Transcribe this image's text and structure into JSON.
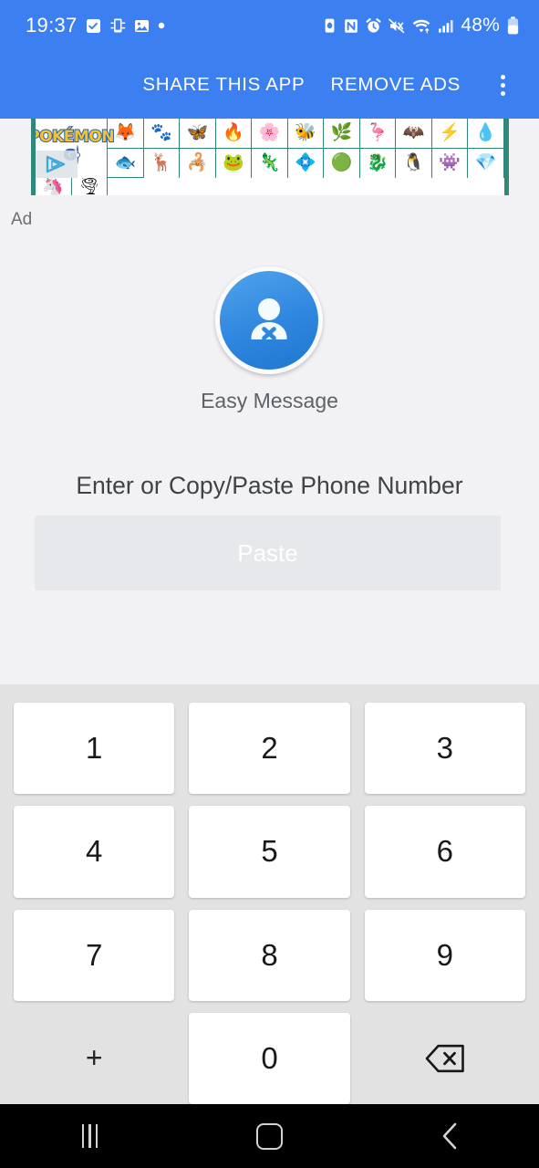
{
  "status_bar": {
    "time": "19:37",
    "battery_percent": "48%",
    "left_icons": [
      "tasks-checkbox-icon",
      "phone-link-icon",
      "gallery-image-icon",
      "dot-indicator-icon"
    ],
    "right_icons": [
      "power-saving-icon",
      "nfc-icon",
      "alarm-icon",
      "mute-vibrate-icon",
      "wifi-icon",
      "signal-bars-icon",
      "battery-icon"
    ],
    "background_color": "#3b7ff0"
  },
  "toolbar": {
    "share_label": "SHARE THIS APP",
    "remove_ads_label": "REMOVE ADS",
    "overflow_icon": "more-vertical-icon",
    "background_color": "#3b7ff0"
  },
  "ad": {
    "label": "Ad",
    "advertiser": "Pokémon GO",
    "logo_word": "POKÉMON",
    "logo_sub": "GO",
    "adchoices_icon": "adchoices-triangle-icon",
    "border_color": "#2f8878",
    "sprites_row1": [
      "🦊",
      "🐾",
      "🦋",
      "🔥",
      "🌸",
      "🐝",
      "🌿",
      "🦩",
      "🦇",
      "⚡",
      "💧",
      "🐟"
    ],
    "sprites_row2": [
      "🦌",
      "🦂",
      "🐸",
      "🦎",
      "💠",
      "🟢",
      "🐉",
      "🐧",
      "👾",
      "💎",
      "🦄",
      "🌪"
    ]
  },
  "app": {
    "icon_name": "person-with-x-icon",
    "name": "Easy Message",
    "accent_color": "#2f86de"
  },
  "main": {
    "prompt": "Enter or Copy/Paste Phone Number",
    "paste_button_label": "Paste",
    "paste_button_enabled": false
  },
  "keypad": {
    "keys": [
      {
        "label": "1",
        "name": "key-1",
        "style": "card"
      },
      {
        "label": "2",
        "name": "key-2",
        "style": "card"
      },
      {
        "label": "3",
        "name": "key-3",
        "style": "card"
      },
      {
        "label": "4",
        "name": "key-4",
        "style": "card"
      },
      {
        "label": "5",
        "name": "key-5",
        "style": "card"
      },
      {
        "label": "6",
        "name": "key-6",
        "style": "card"
      },
      {
        "label": "7",
        "name": "key-7",
        "style": "card"
      },
      {
        "label": "8",
        "name": "key-8",
        "style": "card"
      },
      {
        "label": "9",
        "name": "key-9",
        "style": "card"
      },
      {
        "label": "+",
        "name": "key-plus",
        "style": "flat"
      },
      {
        "label": "0",
        "name": "key-0",
        "style": "card"
      },
      {
        "label": "",
        "name": "key-backspace",
        "style": "flat-icon"
      }
    ],
    "background_color": "#e2e2e2"
  },
  "navigation_bar": {
    "recents_icon": "recents-icon",
    "home_icon": "home-icon",
    "back_icon": "back-chevron-icon"
  }
}
